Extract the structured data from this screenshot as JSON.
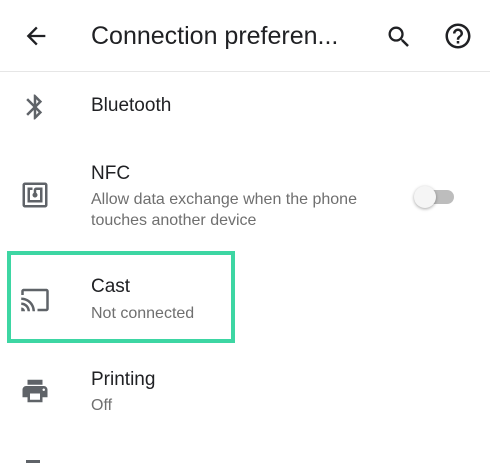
{
  "appbar": {
    "title": "Connection preferen...",
    "icons": [
      "back-arrow-icon",
      "search-icon",
      "help-icon"
    ]
  },
  "settings": {
    "bluetooth": {
      "icon": "bluetooth-icon",
      "label": "Bluetooth"
    },
    "nfc": {
      "icon": "nfc-icon",
      "label": "NFC",
      "summary_line1": "Allow data exchange when the phone",
      "summary_line2": "touches another device",
      "toggle_state": "off"
    },
    "cast": {
      "icon": "cast-icon",
      "label": "Cast",
      "summary": "Not connected",
      "highlighted": true
    },
    "printing": {
      "icon": "printer-icon",
      "label": "Printing",
      "summary": "Off"
    }
  },
  "colors": {
    "primary_text": "#202124",
    "secondary_text": "#6f6f6f",
    "icon": "#5f6368",
    "highlight": "#3dd6a3",
    "toggle_track": "#bdbdbd",
    "toggle_thumb": "#f5f5f5"
  }
}
